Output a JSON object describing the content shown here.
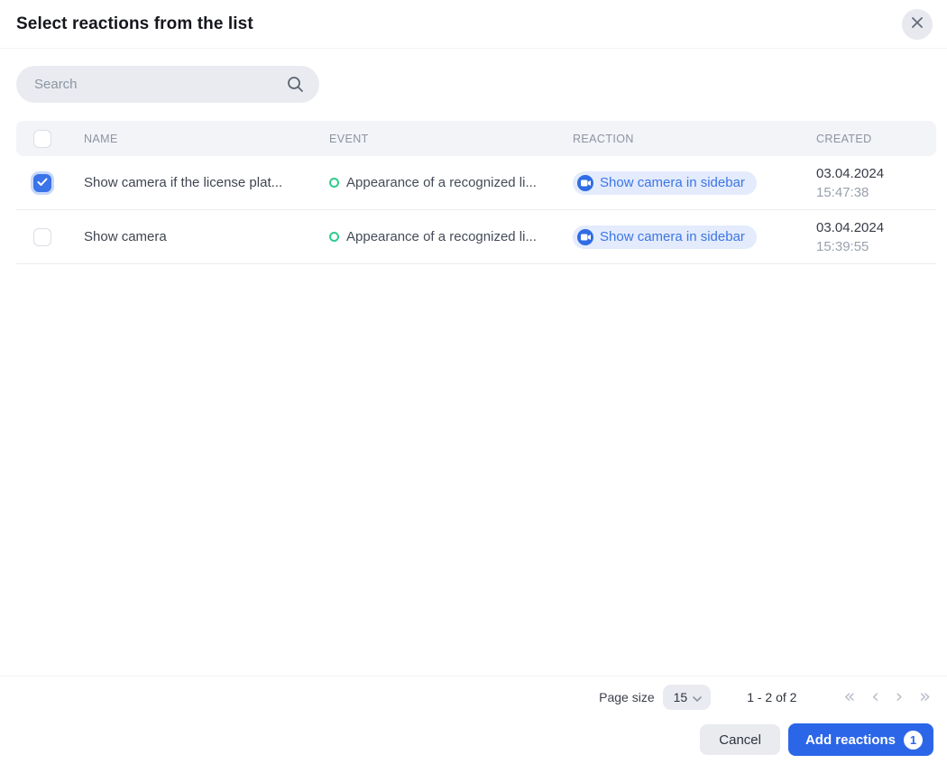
{
  "modal": {
    "title": "Select reactions from the list"
  },
  "search": {
    "placeholder": "Search"
  },
  "table": {
    "columns": {
      "name": "NAME",
      "event": "EVENT",
      "reaction": "REACTION",
      "created": "CREATED"
    },
    "rows": [
      {
        "checked": true,
        "name": "Show camera if the license plat...",
        "event": "Appearance of a recognized li...",
        "reaction": "Show camera in sidebar",
        "created_date": "03.04.2024",
        "created_time": "15:47:38"
      },
      {
        "checked": false,
        "name": "Show camera",
        "event": "Appearance of a recognized li...",
        "reaction": "Show camera in sidebar",
        "created_date": "03.04.2024",
        "created_time": "15:39:55"
      }
    ]
  },
  "pagination": {
    "page_size_label": "Page size",
    "page_size_value": "15",
    "range_text": "1 - 2 of 2",
    "first_icon": "«",
    "prev_icon": "‹",
    "next_icon": "›",
    "last_icon": "»"
  },
  "footer": {
    "cancel_label": "Cancel",
    "add_label": "Add reactions",
    "add_count": "1"
  },
  "colors": {
    "accent_blue": "#2c66e8",
    "checkbox_checked": "#3b74e8",
    "badge_bg": "#e3ebfc",
    "badge_text": "#3d76e4",
    "event_ring_green": "#2fcb8e",
    "table_head_bg": "#f3f4f8",
    "search_bg": "#e9ebf0"
  }
}
